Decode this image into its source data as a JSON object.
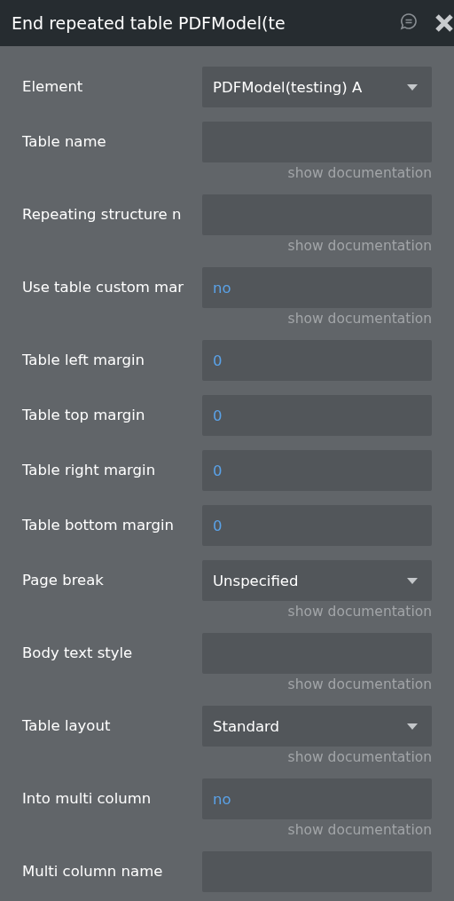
{
  "window": {
    "title": "End repeated table PDFModel(te"
  },
  "fields": [
    {
      "label": "Element",
      "kind": "dropdown",
      "value": "PDFModel(testing) A"
    },
    {
      "label": "Table name",
      "kind": "input",
      "documentation_link": "show documentation"
    },
    {
      "label": "Repeating structure n",
      "kind": "input",
      "documentation_link": "show documentation"
    },
    {
      "label": "Use table custom mar",
      "kind": "input",
      "value": "no",
      "documentation_link": "show documentation"
    },
    {
      "label": "Table left margin",
      "kind": "input",
      "value": "0"
    },
    {
      "label": "Table top margin",
      "kind": "input",
      "value": "0"
    },
    {
      "label": "Table right margin",
      "kind": "input",
      "value": "0"
    },
    {
      "label": "Table bottom margin",
      "kind": "input",
      "value": "0"
    },
    {
      "label": "Page break",
      "kind": "dropdown",
      "value": "Unspecified",
      "documentation_link": "show documentation"
    },
    {
      "label": "Body text style",
      "kind": "input",
      "documentation_link": "show documentation"
    },
    {
      "label": "Table layout",
      "kind": "dropdown",
      "value": "Standard",
      "documentation_link": "show documentation"
    },
    {
      "label": "Into multi column",
      "kind": "input",
      "value": "no",
      "documentation_link": "show documentation"
    },
    {
      "label": "Multi column name",
      "kind": "input"
    }
  ]
}
